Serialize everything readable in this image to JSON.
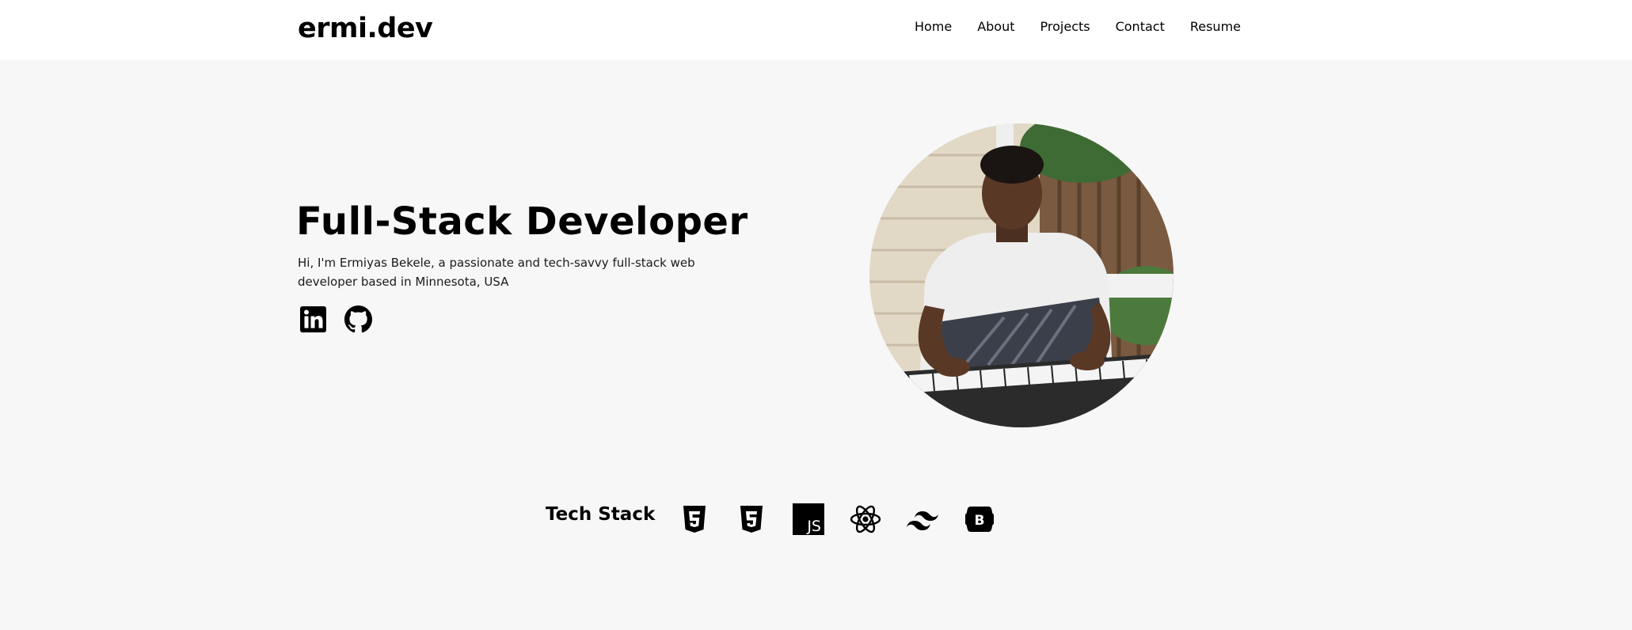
{
  "header": {
    "logo": "ermi.dev",
    "nav": [
      {
        "label": "Home"
      },
      {
        "label": "About"
      },
      {
        "label": "Projects"
      },
      {
        "label": "Contact"
      },
      {
        "label": "Resume"
      }
    ]
  },
  "hero": {
    "title": "Full-Stack Developer",
    "description": "Hi, I'm Ermiyas Bekele, a passionate and tech-savvy full-stack web developer based in Minnesota, USA",
    "socials": [
      {
        "icon": "linkedin-icon"
      },
      {
        "icon": "github-icon"
      }
    ],
    "portrait_icon": "profile-photo"
  },
  "tech_stack": {
    "label": "Tech Stack",
    "icons": [
      "html5-icon",
      "css3-icon",
      "javascript-icon",
      "react-icon",
      "tailwind-icon",
      "bootstrap-icon"
    ]
  },
  "colors": {
    "background": "#f7f7f7",
    "header_background": "#ffffff",
    "text": "#000000"
  }
}
